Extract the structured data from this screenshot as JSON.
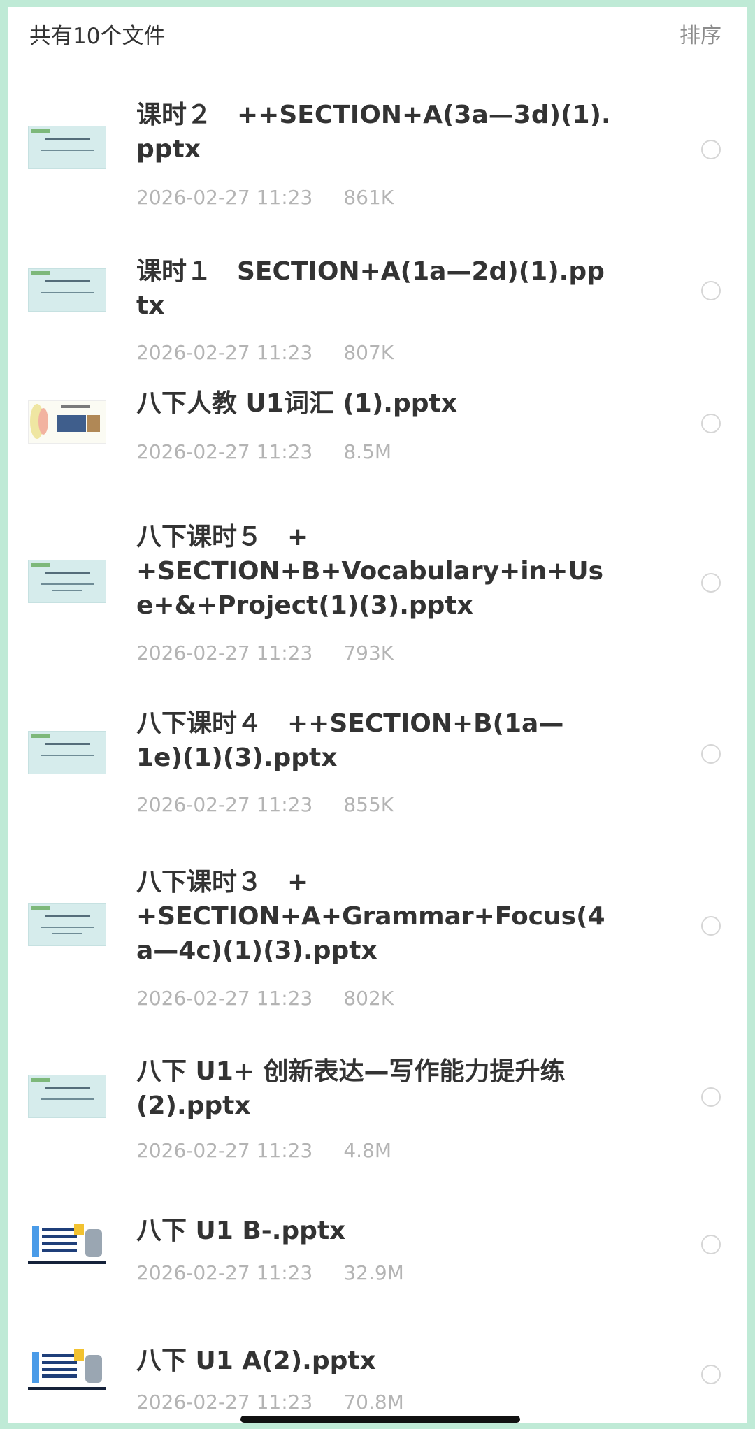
{
  "header": {
    "count_label": "共有10个文件",
    "sort_label": "排序"
  },
  "files": [
    {
      "name": "课时２　++SECTION+A(3a—3d)(1).pptx",
      "date": "2026-02-27 11:23",
      "size": "861K",
      "thumb": "thumb-unit-slide"
    },
    {
      "name": "课时１　SECTION+A(1a—2d)(1).pptx",
      "date": "2026-02-27 11:23",
      "size": "807K",
      "thumb": "thumb-unit-slide"
    },
    {
      "name": "八下人教 U1词汇 (1).pptx",
      "date": "2026-02-27 11:23",
      "size": "8.5M",
      "thumb": "thumb-vocab-slide"
    },
    {
      "name": "八下课时５　+\n+SECTION+B+Vocabulary+in+Us\ne+&+Project(1)(3).pptx",
      "date": "2026-02-27 11:23",
      "size": "793K",
      "thumb": "thumb-unit-slide"
    },
    {
      "name": "八下课时４　++SECTION+B(1a—\n1e)(1)(3).pptx",
      "date": "2026-02-27 11:23",
      "size": "855K",
      "thumb": "thumb-unit-slide"
    },
    {
      "name": "八下课时３　+\n+SECTION+A+Grammar+Focus(4\na—4c)(1)(3).pptx",
      "date": "2026-02-27 11:23",
      "size": "802K",
      "thumb": "thumb-unit-slide"
    },
    {
      "name": "八下 U1+ 创新表达—写作能力提升练\n(2).pptx",
      "date": "2026-02-27 11:23",
      "size": "4.8M",
      "thumb": "thumb-unit-slide"
    },
    {
      "name": "八下 U1 B-.pptx",
      "date": "2026-02-27 11:23",
      "size": "32.9M",
      "thumb": "thumb-content-slide"
    },
    {
      "name": "八下 U1 A(2).pptx",
      "date": "2026-02-27 11:23",
      "size": "70.8M",
      "thumb": "thumb-content-slide"
    }
  ]
}
